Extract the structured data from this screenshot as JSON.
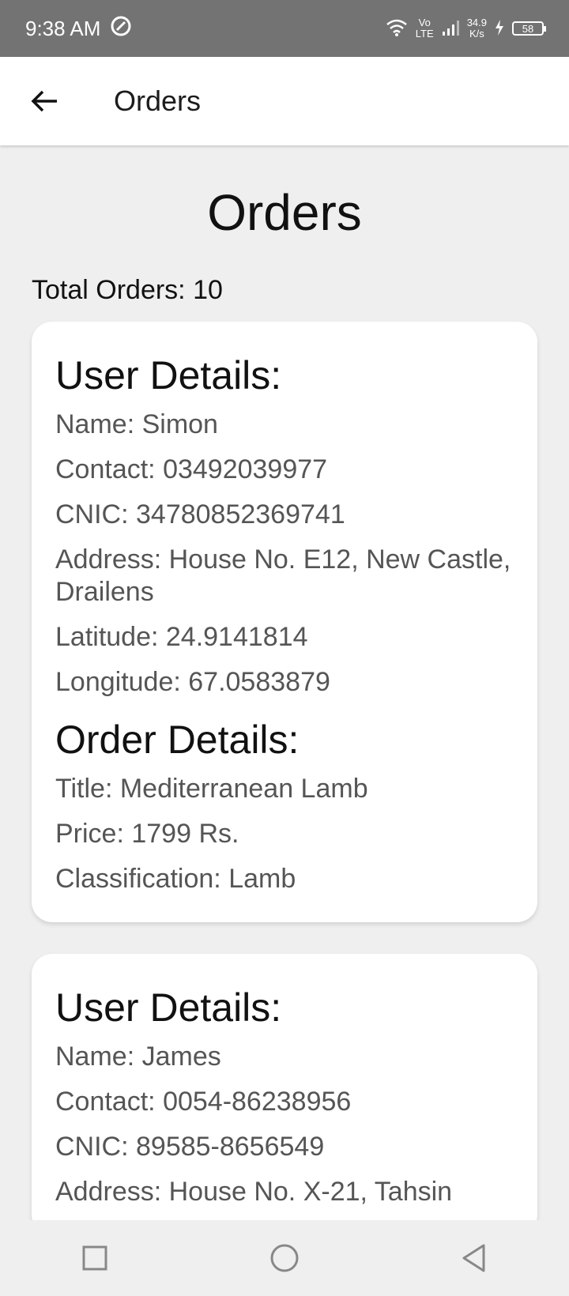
{
  "status": {
    "time": "9:38 AM",
    "net_top": "Vo",
    "net_bottom": "LTE",
    "speed_top": "34.9",
    "speed_bottom": "K/s",
    "battery": "58"
  },
  "app_bar": {
    "title": "Orders",
    "back_icon": "arrow-back-icon"
  },
  "page": {
    "heading": "Orders",
    "total": "Total Orders: 10"
  },
  "orders": [
    {
      "user_title": "User Details:",
      "name": "Name: Simon",
      "contact": "Contact: 03492039977",
      "cnic": "CNIC: 34780852369741",
      "address": "Address: House No. E12, New Castle, Drailens",
      "latitude": "Latitude: 24.9141814",
      "longitude": "Longitude: 67.0583879",
      "order_title": "Order Details:",
      "title": "Title: Mediterranean Lamb",
      "price": "Price: 1799 Rs.",
      "classification": "Classification: Lamb"
    },
    {
      "user_title": "User Details:",
      "name": "Name: James",
      "contact": "Contact: 0054-86238956",
      "cnic": "CNIC: 89585-8656549",
      "address": "Address: House No. X-21, Tahsin"
    }
  ],
  "nav": {
    "recents_icon": "square-icon",
    "home_icon": "circle-icon",
    "back_icon": "triangle-back-icon"
  },
  "colors": {
    "status_bar": "#737373",
    "background": "#efefef",
    "card": "#ffffff",
    "text_secondary": "#555555"
  }
}
